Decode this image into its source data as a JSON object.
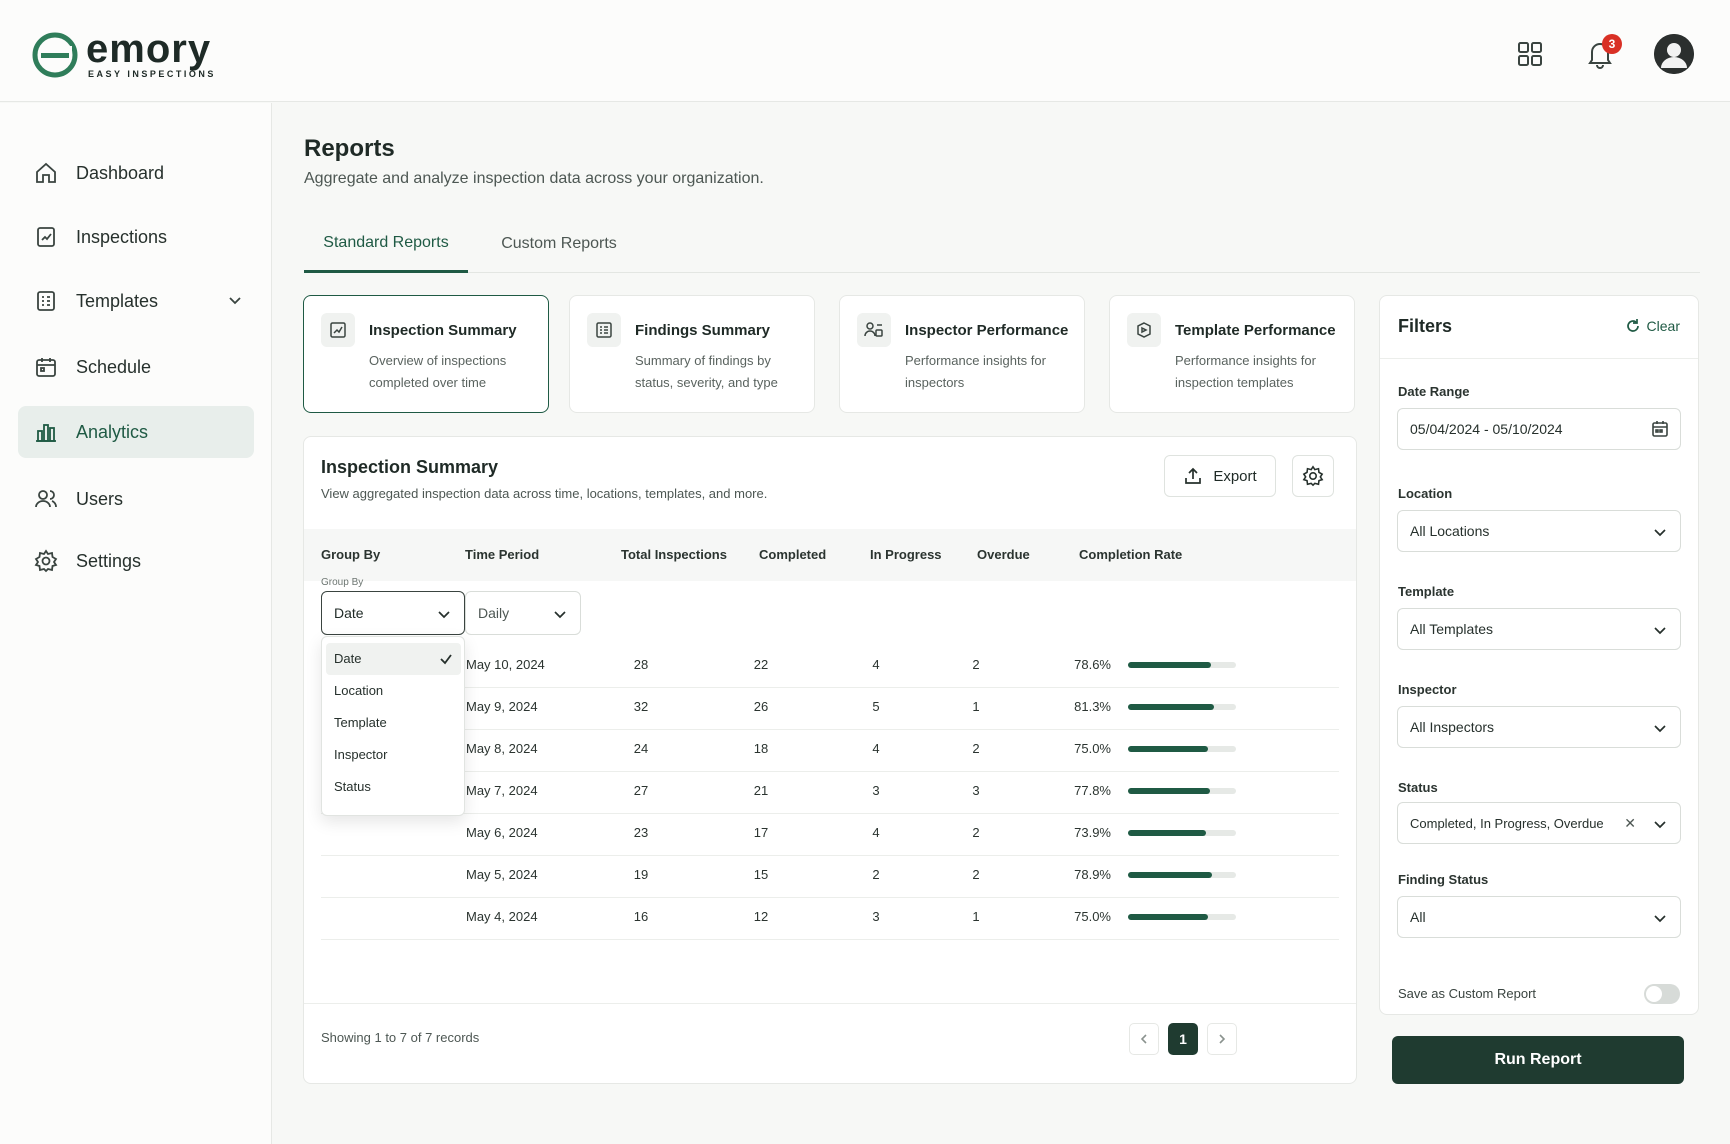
{
  "brand": {
    "name": "emory",
    "tagline": "EASY INSPECTIONS",
    "accent": "#1f5a44",
    "dark": "#1f3b30"
  },
  "topbar": {
    "notifications_count": "3",
    "icons": [
      "grid-icon",
      "bell-icon",
      "avatar"
    ]
  },
  "sidebar": {
    "items": [
      {
        "label": "Dashboard",
        "icon": "home-icon"
      },
      {
        "label": "Inspections",
        "icon": "clipboard-icon"
      },
      {
        "label": "Templates",
        "icon": "template-icon"
      },
      {
        "label": "Schedule",
        "icon": "calendar-icon"
      },
      {
        "label": "Analytics",
        "icon": "bar-chart-icon",
        "active": true
      },
      {
        "label": "Users",
        "icon": "users-icon"
      },
      {
        "label": "Settings",
        "icon": "gear-icon"
      }
    ]
  },
  "page": {
    "title": "Reports",
    "subtitle": "Aggregate and analyze inspection data across your organization.",
    "tabs": [
      {
        "label": "Standard Reports",
        "active": true
      },
      {
        "label": "Custom Reports"
      }
    ]
  },
  "report_cards": [
    {
      "title": "Inspection Summary",
      "desc": "Overview of inspections completed over time",
      "active": true
    },
    {
      "title": "Findings Summary",
      "desc": "Summary of findings by status, severity, and type"
    },
    {
      "title": "Inspector Performance",
      "desc": "Performance insights for inspectors"
    },
    {
      "title": "Template Performance",
      "desc": "Performance insights for inspection templates"
    }
  ],
  "panel": {
    "title": "Inspection Summary",
    "subtitle": "View aggregated inspection data across time, locations, templates, and more.",
    "export_label": "Export",
    "columns": [
      "Group By",
      "Time Period",
      "Total Inspections",
      "Completed",
      "In Progress",
      "Overdue",
      "Completion Rate"
    ],
    "group_by_mini_label": "Group By",
    "group_by_value": "Date",
    "time_period_value": "Daily",
    "group_by_options": [
      "Date",
      "Location",
      "Template",
      "Inspector",
      "Status"
    ],
    "rows": [
      {
        "date": "May 10, 2024",
        "total": "28",
        "completed": "22",
        "in_progress": "4",
        "overdue": "2",
        "rate": "78.6%",
        "rate_value": 78.6
      },
      {
        "date": "May 9, 2024",
        "total": "32",
        "completed": "26",
        "in_progress": "5",
        "overdue": "1",
        "rate": "81.3%",
        "rate_value": 81.3
      },
      {
        "date": "May 8, 2024",
        "total": "24",
        "completed": "18",
        "in_progress": "4",
        "overdue": "2",
        "rate": "75.0%",
        "rate_value": 75.0
      },
      {
        "date": "May 7, 2024",
        "total": "27",
        "completed": "21",
        "in_progress": "3",
        "overdue": "3",
        "rate": "77.8%",
        "rate_value": 77.8
      },
      {
        "date": "May 6, 2024",
        "total": "23",
        "completed": "17",
        "in_progress": "4",
        "overdue": "2",
        "rate": "73.9%",
        "rate_value": 73.9
      },
      {
        "date": "May 5, 2024",
        "total": "19",
        "completed": "15",
        "in_progress": "2",
        "overdue": "2",
        "rate": "78.9%",
        "rate_value": 78.9
      },
      {
        "date": "May 4, 2024",
        "total": "16",
        "completed": "12",
        "in_progress": "3",
        "overdue": "1",
        "rate": "75.0%",
        "rate_value": 75.0
      }
    ],
    "showing": "Showing 1 to 7 of 7 records",
    "current_page": "1"
  },
  "filters": {
    "title": "Filters",
    "clear_label": "Clear",
    "date_range_label": "Date Range",
    "date_range_value": "05/04/2024 - 05/10/2024",
    "location_label": "Location",
    "location_value": "All Locations",
    "template_label": "Template",
    "template_value": "All Templates",
    "inspector_label": "Inspector",
    "inspector_value": "All Inspectors",
    "status_label": "Status",
    "status_value": "Completed, In Progress, Overdue",
    "finding_status_label": "Finding Status",
    "finding_status_value": "All",
    "save_custom_label": "Save as Custom Report",
    "save_custom_on": false
  },
  "run_report_label": "Run Report"
}
